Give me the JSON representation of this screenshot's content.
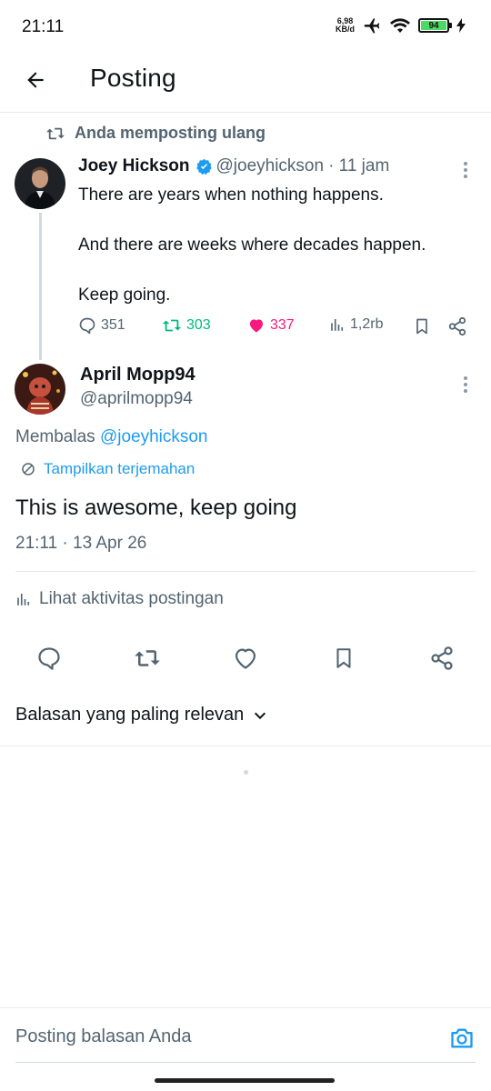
{
  "status_bar": {
    "time": "21:11",
    "net_speed_value": "6,98",
    "net_speed_unit": "KB/d",
    "battery": "94"
  },
  "header": {
    "title": "Posting"
  },
  "repost": {
    "label": "Anda memposting ulang"
  },
  "original_post": {
    "author_name": "Joey Hickson",
    "handle": "@joeyhickson",
    "time": "· 11 jam",
    "lines": [
      "There are years when nothing happens.",
      "And there are weeks where decades happen.",
      "Keep going."
    ],
    "replies": "351",
    "reposts": "303",
    "likes": "337",
    "views": "1,2rb"
  },
  "reply_post": {
    "author_name": "April Mopp94",
    "handle": "@aprilmopp94",
    "replying_prefix": "Membalas",
    "replying_to": "@joeyhickson",
    "translate_label": "Tampilkan terjemahan",
    "text": "This is awesome, keep going",
    "timestamp": "21:11 · 13 Apr 26",
    "activity_label": "Lihat aktivitas postingan"
  },
  "sort": {
    "label": "Balasan yang paling relevan"
  },
  "composer": {
    "placeholder": "Posting balasan Anda"
  },
  "colors": {
    "accent": "#1d9bf0",
    "repost_green": "#00ba7c",
    "like_pink": "#f91880",
    "muted": "#536471"
  },
  "icons": [
    "back-arrow-icon",
    "repost-icon",
    "verified-badge-icon",
    "more-icon",
    "reply-icon",
    "like-icon",
    "views-icon",
    "bookmark-icon",
    "share-icon",
    "translate-icon",
    "camera-icon",
    "chevron-down-icon"
  ]
}
